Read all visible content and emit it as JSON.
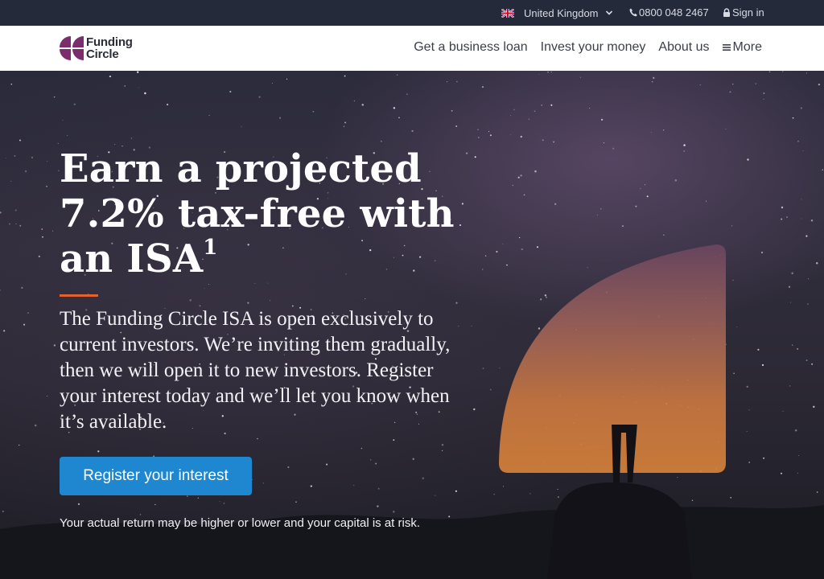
{
  "topbar": {
    "country": "United Kingdom",
    "phone": "0800 048 2467",
    "signin": "Sign in"
  },
  "logo": {
    "line1": "Funding",
    "line2": "Circle"
  },
  "nav": {
    "items": [
      {
        "label": "Get a business loan"
      },
      {
        "label": "Invest your money"
      },
      {
        "label": "About us"
      },
      {
        "label": "More"
      }
    ]
  },
  "hero": {
    "headline": "Earn a projected 7.2% tax-free with an ISA",
    "headline_sup": "1",
    "lead": "The Funding Circle ISA is open exclusively to current investors. We’re inviting them gradually, then we will open it to new investors. Register your interest today and we’ll let you know when it’s available.",
    "cta": "Register your interest",
    "disclaimer": "Your actual return may be higher or lower and your capital is at risk."
  },
  "colors": {
    "topbar": "#252a3b",
    "brand_purple": "#7b2d6e",
    "accent_orange": "#e3622a",
    "cta_blue": "#1f87d0"
  },
  "icons": [
    "uk-flag-icon",
    "chevron-down-icon",
    "phone-icon",
    "lock-icon",
    "menu-icon",
    "funding-circle-logo"
  ]
}
